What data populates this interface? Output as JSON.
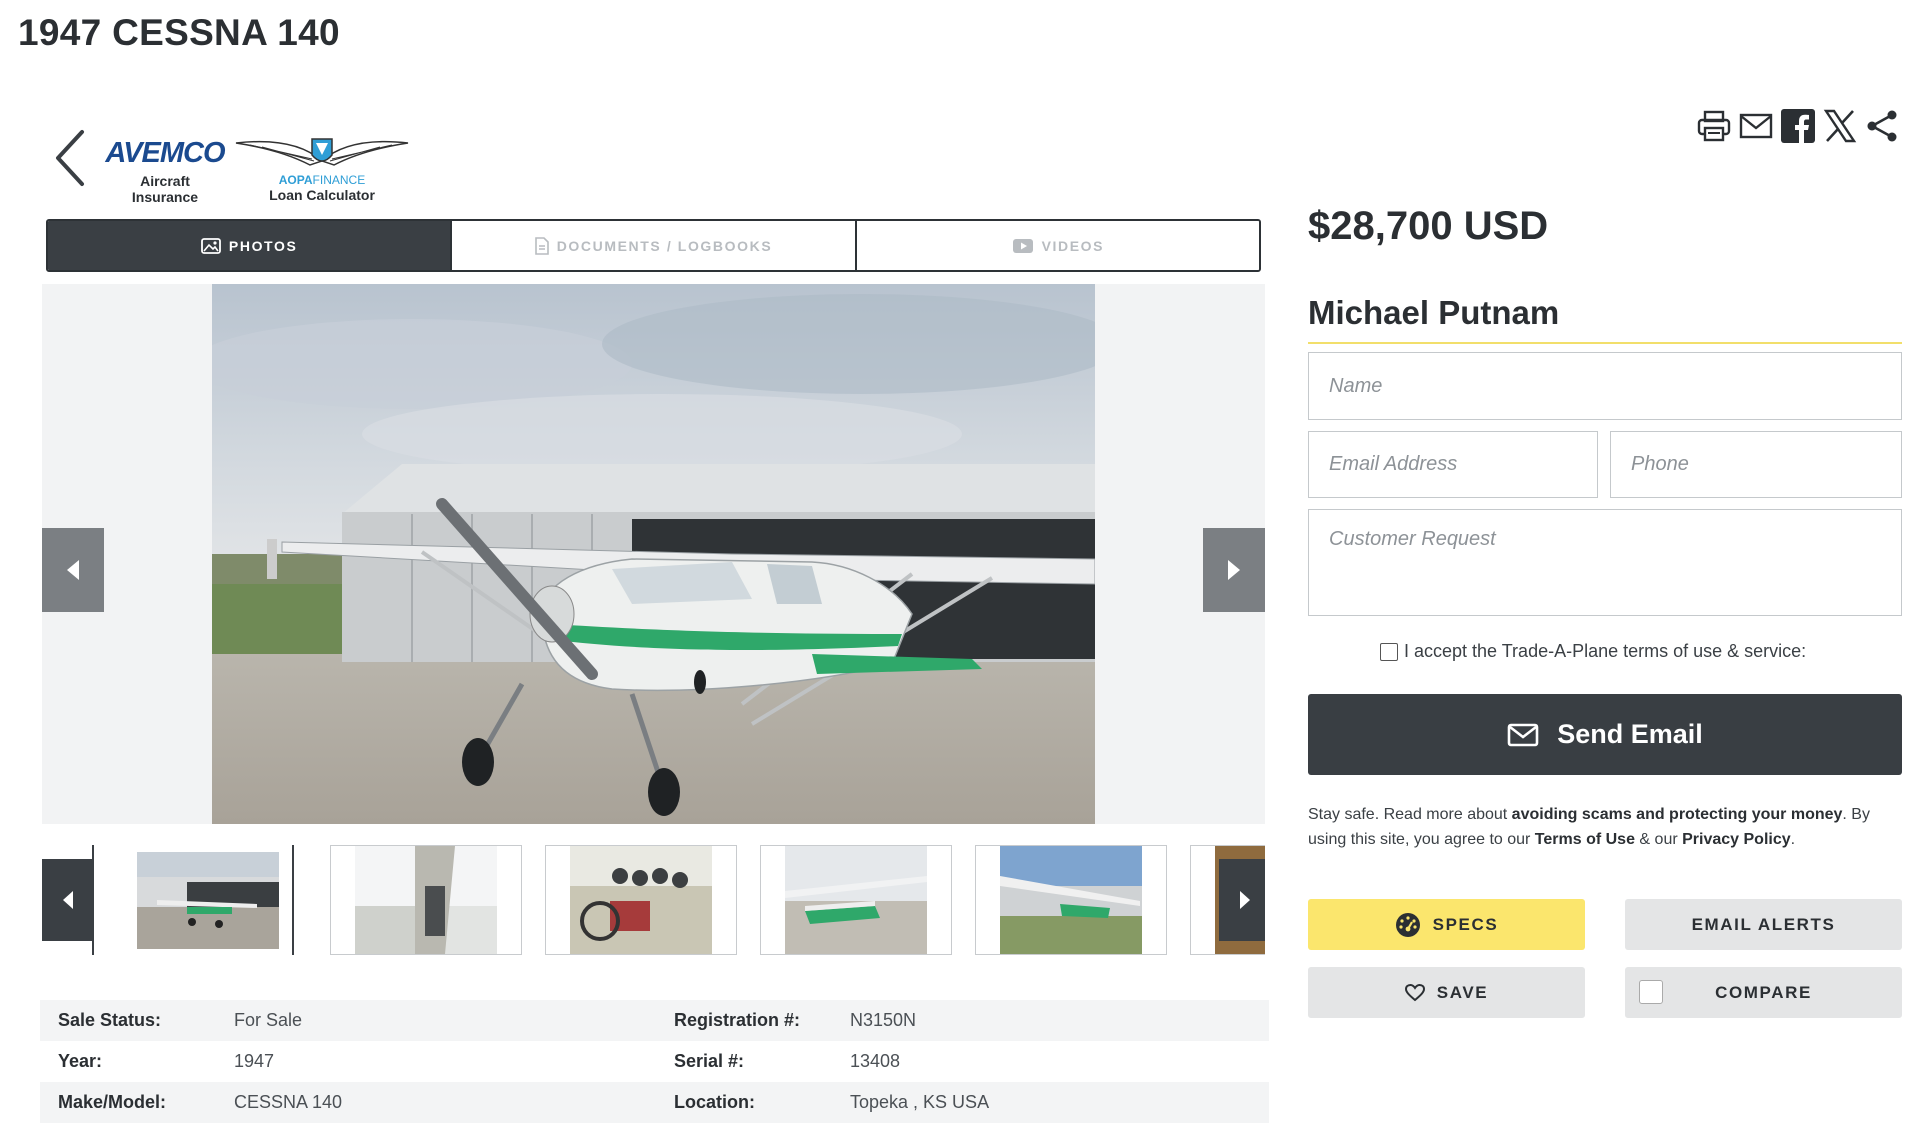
{
  "listing": {
    "title": "1947 CESSNA 140",
    "price": "$28,700 USD",
    "seller_name": "Michael Putnam"
  },
  "partners": [
    {
      "logo_text": "AVEMCO",
      "label_line1": "Aircraft",
      "label_line2": "Insurance"
    },
    {
      "brand_bold": "AOPA",
      "brand_rest": "FINANCE",
      "label": "Loan Calculator"
    }
  ],
  "share_icons": [
    "print-icon",
    "email-icon",
    "facebook-icon",
    "x-icon",
    "share-icon"
  ],
  "tabs": [
    {
      "label": "PHOTOS",
      "icon": "image-icon",
      "active": true
    },
    {
      "label": "DOCUMENTS / LOGBOOKS",
      "icon": "document-icon",
      "active": false
    },
    {
      "label": "VIDEOS",
      "icon": "video-icon",
      "active": false
    }
  ],
  "specs": [
    {
      "k1": "Sale Status:",
      "v1": "For Sale",
      "k2": "Registration #:",
      "v2": "N3150N"
    },
    {
      "k1": "Year:",
      "v1": "1947",
      "k2": "Serial #:",
      "v2": "13408"
    },
    {
      "k1": "Make/Model:",
      "v1": "CESSNA 140",
      "k2": "Location:",
      "v2": "Topeka , KS USA"
    }
  ],
  "form": {
    "name_placeholder": "Name",
    "email_placeholder": "Email Address",
    "phone_placeholder": "Phone",
    "request_placeholder": "Customer Request",
    "terms_text": "I accept the Trade-A-Plane terms of use & service:",
    "send_label": "Send Email"
  },
  "disclaimer": {
    "part1": "Stay safe. Read more about ",
    "bold1": "avoiding scams and protecting your money",
    "part2": ". By using this site, you agree to our ",
    "link1": "Terms of Use",
    "part3": " & our ",
    "link2": "Privacy Policy",
    "part4": "."
  },
  "actions": {
    "specs": "SPECS",
    "email_alerts": "EMAIL ALERTS",
    "save": "SAVE",
    "compare": "COMPARE"
  },
  "colors": {
    "dark": "#393e43",
    "accent_yellow": "#fbe66d",
    "light_gray": "#e4e5e6",
    "aircraft_green": "#2fa86a"
  }
}
